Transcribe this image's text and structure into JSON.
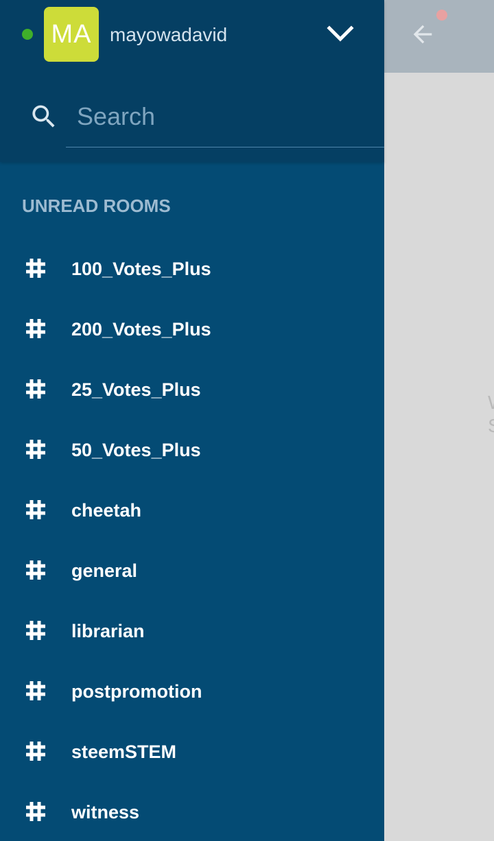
{
  "account": {
    "avatar_initials": "MA",
    "username": "mayowadavid",
    "status": "online",
    "status_color": "#3fae2a",
    "avatar_color": "#cddc39"
  },
  "search": {
    "placeholder": "Search",
    "value": ""
  },
  "section": {
    "title": "UNREAD ROOMS"
  },
  "rooms": [
    {
      "label": "100_Votes_Plus",
      "icon": "hashtag-icon"
    },
    {
      "label": "200_Votes_Plus",
      "icon": "hashtag-icon"
    },
    {
      "label": "25_Votes_Plus",
      "icon": "hashtag-icon"
    },
    {
      "label": "50_Votes_Plus",
      "icon": "hashtag-icon"
    },
    {
      "label": "cheetah",
      "icon": "hashtag-icon"
    },
    {
      "label": "general",
      "icon": "hashtag-icon"
    },
    {
      "label": "librarian",
      "icon": "hashtag-icon"
    },
    {
      "label": "postpromotion",
      "icon": "hashtag-icon"
    },
    {
      "label": "steemSTEM",
      "icon": "hashtag-icon"
    },
    {
      "label": "witness",
      "icon": "hashtag-icon"
    }
  ],
  "colors": {
    "drawer_background": "#044b74",
    "drawer_header": "#053f63",
    "section_title": "#9dbbd1"
  },
  "background": {
    "peek_text": "W\nS"
  }
}
